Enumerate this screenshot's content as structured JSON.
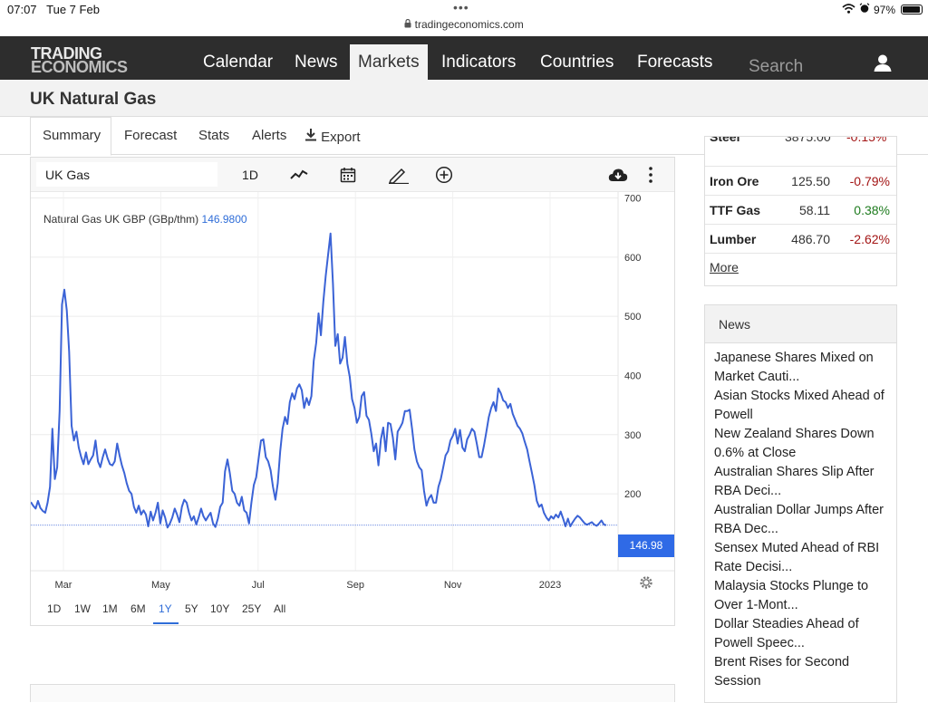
{
  "status_bar": {
    "time": "07:07",
    "date": "Tue 7 Feb",
    "url": "tradingeconomics.com",
    "battery": "97%",
    "battery_level": 0.97
  },
  "logo": {
    "line1": "TRADING",
    "line2": "ECONOMICS"
  },
  "nav": {
    "items": [
      {
        "label": "Calendar",
        "active": false
      },
      {
        "label": "News",
        "active": false
      },
      {
        "label": "Markets",
        "active": true
      },
      {
        "label": "Indicators",
        "active": false
      },
      {
        "label": "Countries",
        "active": false
      },
      {
        "label": "Forecasts",
        "active": false
      }
    ],
    "search_placeholder": "Search"
  },
  "page": {
    "title": "UK Natural Gas"
  },
  "subtabs": [
    "Summary",
    "Forecast",
    "Stats",
    "Alerts",
    "Export"
  ],
  "chart_toolbar": {
    "symbol": "UK Gas",
    "interval": "1D"
  },
  "chart_data": {
    "type": "line",
    "title": "Natural Gas UK GBP (GBp/thm)",
    "current_value": "146.9800",
    "price_tag": "146.98",
    "y_ticks": [
      "700",
      "600",
      "500",
      "400",
      "300",
      "200"
    ],
    "x_ticks": [
      "Mar",
      "May",
      "Jul",
      "Sep",
      "Nov",
      "2023"
    ],
    "ylim": [
      70,
      710
    ],
    "series": [
      {
        "color": "#3b63d6",
        "values": [
          186,
          180,
          175,
          188,
          176,
          171,
          168,
          185,
          212,
          310,
          225,
          245,
          340,
          520,
          545,
          510,
          440,
          315,
          290,
          305,
          278,
          262,
          250,
          270,
          250,
          258,
          265,
          290,
          255,
          245,
          262,
          275,
          260,
          250,
          248,
          255,
          285,
          265,
          248,
          235,
          218,
          205,
          200,
          178,
          168,
          180,
          165,
          172,
          165,
          145,
          170,
          155,
          168,
          185,
          150,
          172,
          160,
          143,
          150,
          160,
          175,
          165,
          152,
          178,
          190,
          185,
          168,
          155,
          162,
          148,
          160,
          175,
          162,
          155,
          162,
          168,
          150,
          144,
          158,
          178,
          185,
          238,
          258,
          235,
          205,
          200,
          185,
          180,
          195,
          172,
          168,
          150,
          185,
          215,
          228,
          260,
          290,
          292,
          262,
          255,
          240,
          212,
          190,
          218,
          272,
          310,
          330,
          318,
          355,
          370,
          360,
          378,
          385,
          375,
          345,
          362,
          350,
          365,
          425,
          455,
          505,
          468,
          525,
          568,
          605,
          640,
          555,
          450,
          470,
          420,
          430,
          465,
          420,
          398,
          360,
          345,
          320,
          330,
          365,
          372,
          332,
          325,
          302,
          272,
          285,
          248,
          292,
          312,
          272,
          320,
          318,
          295,
          258,
          305,
          312,
          320,
          340,
          340,
          342,
          310,
          275,
          255,
          245,
          240,
          205,
          180,
          192,
          198,
          185,
          185,
          212,
          225,
          245,
          265,
          272,
          290,
          298,
          310,
          285,
          308,
          278,
          272,
          292,
          300,
          310,
          305,
          285,
          262,
          262,
          282,
          305,
          330,
          345,
          355,
          340,
          378,
          370,
          358,
          355,
          345,
          352,
          335,
          325,
          315,
          310,
          302,
          288,
          275,
          255,
          235,
          215,
          188,
          178,
          182,
          168,
          160,
          155,
          162,
          158,
          165,
          160,
          170,
          158,
          145,
          158,
          145,
          152,
          158,
          163,
          160,
          155,
          150,
          148,
          150,
          152,
          148,
          146,
          150,
          155,
          148,
          147
        ]
      }
    ]
  },
  "range_buttons": [
    {
      "label": "1D",
      "active": false
    },
    {
      "label": "1W",
      "active": false
    },
    {
      "label": "1M",
      "active": false
    },
    {
      "label": "6M",
      "active": false
    },
    {
      "label": "1Y",
      "active": true
    },
    {
      "label": "5Y",
      "active": false
    },
    {
      "label": "10Y",
      "active": false
    },
    {
      "label": "25Y",
      "active": false
    },
    {
      "label": "All",
      "active": false
    }
  ],
  "commodities": [
    {
      "name": "Iron Ore",
      "price": "125.50",
      "change": "-0.79%",
      "trend": "down"
    },
    {
      "name": "TTF Gas",
      "price": "58.11",
      "change": "0.38%",
      "trend": "up"
    },
    {
      "name": "Lumber",
      "price": "486.70",
      "change": "-2.62%",
      "trend": "down"
    }
  ],
  "more_label": "More",
  "news": {
    "title": "News",
    "items": [
      [
        "Japanese Shares Mixed on",
        "Market Cauti..."
      ],
      [
        "Asian Stocks Mixed Ahead of",
        "Powell"
      ],
      [
        "New Zealand Shares Down",
        "0.6% at Close"
      ],
      [
        "Australian Shares Slip After",
        "RBA Deci..."
      ],
      [
        "Australian Dollar Jumps After",
        "RBA Dec..."
      ],
      [
        "Sensex Muted Ahead of RBI",
        "Rate Decisi..."
      ],
      [
        "Malaysia Stocks Plunge to",
        "Over 1-Mont..."
      ],
      [
        "Dollar Steadies Ahead of",
        "Powell Speec..."
      ],
      [
        "Brent Rises for Second",
        "Session"
      ]
    ]
  }
}
